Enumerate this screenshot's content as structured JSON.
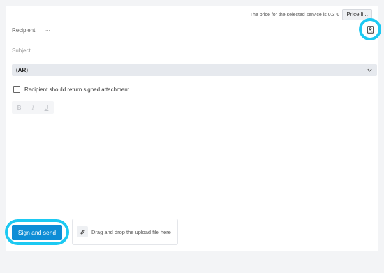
{
  "header": {
    "price_text": "The price for the selected service is 0.3 €",
    "price_button": "Price li..."
  },
  "form": {
    "recipient_label": "Recipient",
    "recipient_placeholder": "...",
    "subject_label": "Subject",
    "select_value": "(AR)",
    "checkbox_label": "Recipient should return signed attachment",
    "checkbox_checked": false
  },
  "toolbar": {
    "bold": "B",
    "italic": "I",
    "underline": "U"
  },
  "footer": {
    "send_button": "Sign and send",
    "drop_text": "Drag and drop the upload file here"
  },
  "colors": {
    "accent": "#0d8dd6",
    "highlight_ring": "#1cc9f2"
  },
  "icons": {
    "contacts": "address-book-icon",
    "dropdown": "chevron-down-icon",
    "attach": "paperclip-icon"
  }
}
